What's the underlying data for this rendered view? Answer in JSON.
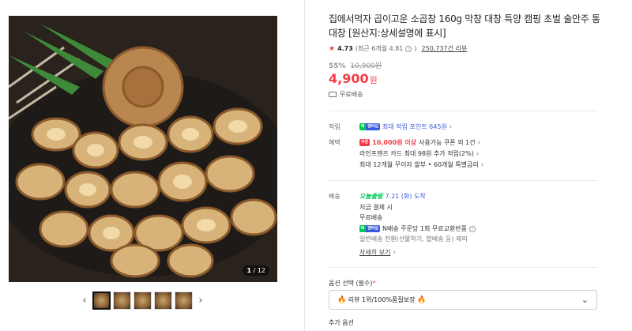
{
  "gallery": {
    "counter_current": "1",
    "counter_total": "/ 12",
    "prev_arrow": "‹",
    "next_arrow": "›",
    "thumbnail_count": 5
  },
  "product": {
    "title": "집에서먹자 곱이고운 소곱창 160g 막창 대창 특양 캠핑 초벌 술안주 통대창 [원산지:상세설명에 표시]",
    "rating": "4.73",
    "recent_rating": "(최근 6개월 4.81",
    "recent_rating_close": ")",
    "review_count": "250,737건 리뷰",
    "discount": "55%",
    "original_price": "10,900원",
    "price": "4,900",
    "price_unit": "원",
    "shipping": "무료배송"
  },
  "points": {
    "label": "적립",
    "badge_n": "N",
    "badge_plus": "멤버십",
    "text": "최대 적립 포인트 645원",
    "chevron": "›"
  },
  "benefits": {
    "label": "혜택",
    "coupon_badge": "쿠폰",
    "line1_red": "10,000원 이상",
    "line1_rest": "사용가능 쿠폰 외 1건",
    "line2": "라인프렌즈 카드 최대 98원 추가 적립(2%)",
    "line3": "최대 12개월 무이자 할부 • 60개월 특별금리",
    "chevron": "›"
  },
  "delivery": {
    "label": "배송",
    "today_badge": "오늘출발",
    "today_text": "7.21 (화) 도착",
    "line1": "지금 결제 시",
    "line2": "무료배송",
    "badge_n": "N",
    "badge_plus": "멤버십",
    "line3": "N배송 주문당 1회 무료교환반품",
    "line4": "일반배송 전환(선물하기, 합배송 등) 제외",
    "detail_link": "자세히 보기",
    "chevron": "›"
  },
  "option": {
    "label": "옵션 선택",
    "required": "(필수)",
    "required_mark": "*",
    "selected": "리뷰 1위/100%품질보장",
    "dropdown_icon": "⌄",
    "fire_icon": "🔥"
  },
  "add_option": {
    "label": "추가 옵션"
  },
  "colors": {
    "accent_red": "#f53c46",
    "naver_green": "#03c75a",
    "link_blue": "#3b5bdb"
  }
}
